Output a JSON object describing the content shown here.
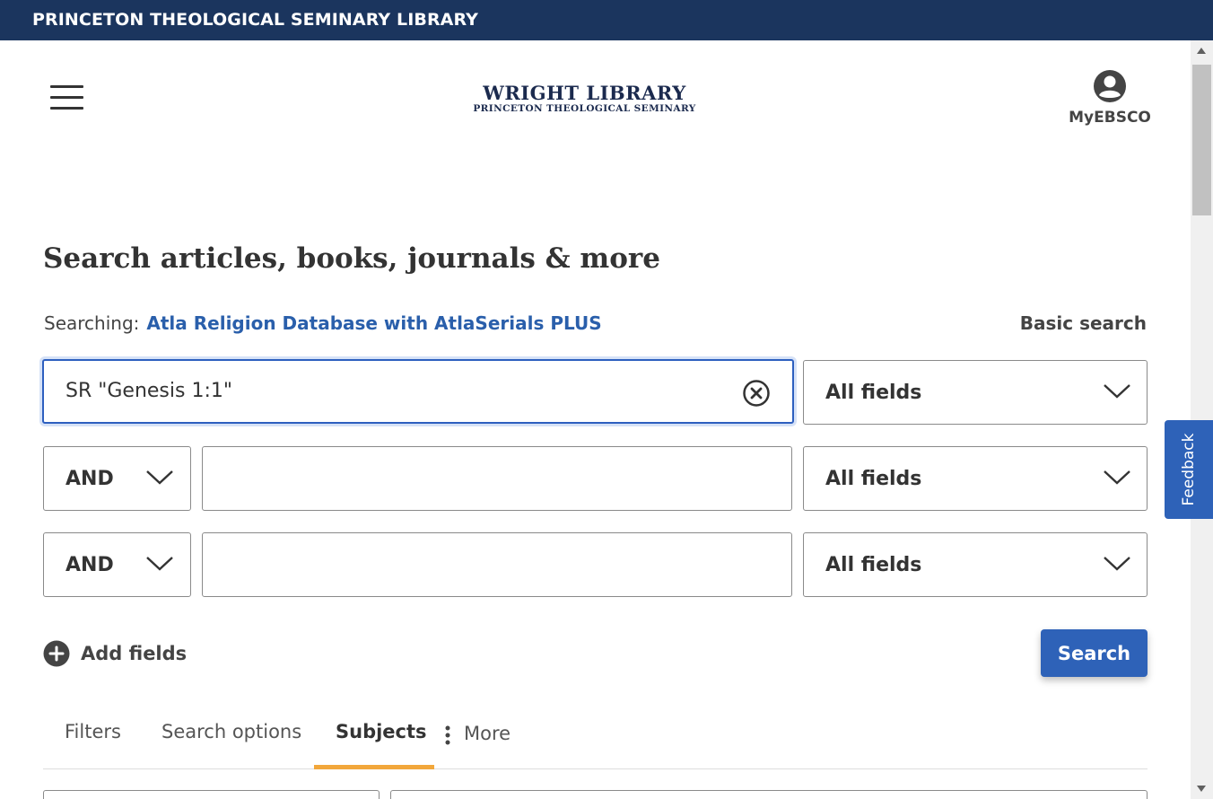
{
  "topbar": {
    "title": "PRINCETON THEOLOGICAL SEMINARY LIBRARY"
  },
  "logo": {
    "line1": "WRIGHT LIBRARY",
    "line2": "PRINCETON THEOLOGICAL SEMINARY"
  },
  "account": {
    "label": "MyEBSCO",
    "icon": "account-circle-icon"
  },
  "headline": "Search articles, books, journals & more",
  "searching": {
    "prefix": "Searching:",
    "database": "Atla Religion Database with AtlaSerials PLUS"
  },
  "basic_search_label": "Basic search",
  "rows": [
    {
      "operator": null,
      "query": "SR \"Genesis 1:1\"",
      "field": "All fields"
    },
    {
      "operator": "AND",
      "query": "",
      "field": "All fields"
    },
    {
      "operator": "AND",
      "query": "",
      "field": "All fields"
    }
  ],
  "add_fields_label": "Add fields",
  "search_button_label": "Search",
  "tabs": [
    {
      "label": "Filters",
      "active": false
    },
    {
      "label": "Search options",
      "active": false
    },
    {
      "label": "Subjects",
      "active": true
    },
    {
      "label": "More",
      "active": false
    }
  ],
  "feedback_label": "Feedback",
  "colors": {
    "topbar": "#1b355e",
    "link": "#2a5fab",
    "primary_button": "#2e62b8",
    "active_tab_underline": "#f2a73b",
    "focus_border": "#2d5fbf"
  }
}
